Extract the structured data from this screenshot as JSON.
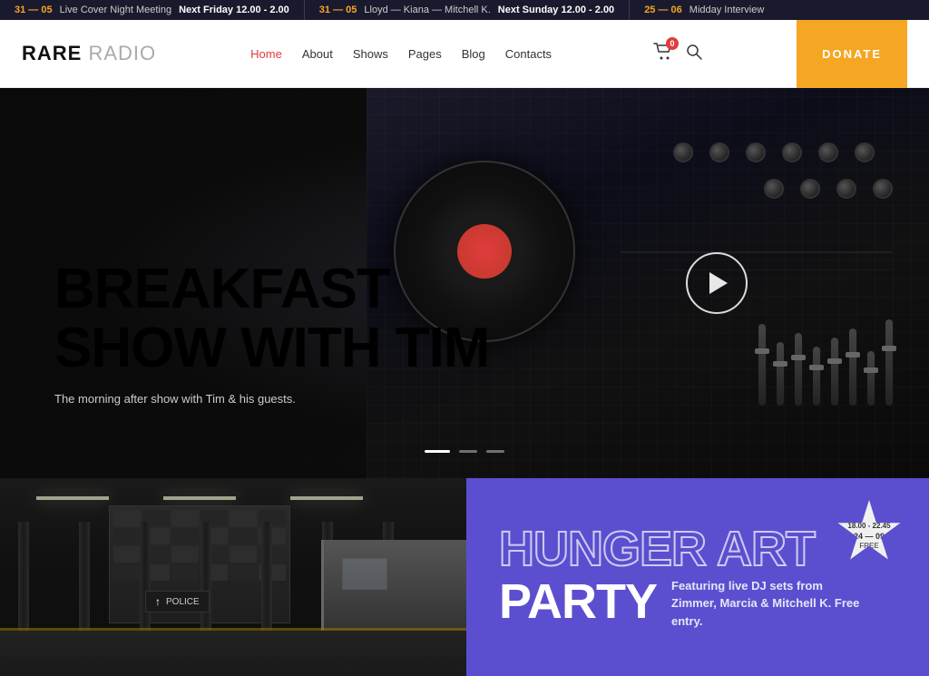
{
  "ticker": {
    "segments": [
      {
        "date": "31 — 05",
        "text": "Live Cover Night Meeting",
        "time": "Next Friday 12.00 - 2.00"
      },
      {
        "date": "31 — 05",
        "text": "Lloyd — Kiana — Mitchell K.",
        "time": "Next Sunday 12.00 - 2.00"
      },
      {
        "date": "25 — 06",
        "text": "Midday Interview",
        "time": ""
      }
    ]
  },
  "header": {
    "logo_bold": "RARE",
    "logo_thin": " RADIO",
    "nav": [
      {
        "label": "Home",
        "active": true
      },
      {
        "label": "About",
        "active": false
      },
      {
        "label": "Shows",
        "active": false
      },
      {
        "label": "Pages",
        "active": false
      },
      {
        "label": "Blog",
        "active": false
      },
      {
        "label": "Contacts",
        "active": false
      }
    ],
    "cart_badge": "0",
    "donate_label": "DONATE"
  },
  "hero": {
    "title_outline": "BREAKFAST",
    "title_solid": "SHOW WITH TIM",
    "subtitle": "The morning after show with Tim & his guests.",
    "slider_dots": [
      true,
      false,
      false
    ]
  },
  "bottom": {
    "police_sign": "POLICE",
    "event_badge_time": "18.00 - 22.45",
    "event_badge_date": "24 — 09",
    "event_badge_free": "FREE",
    "event_title_outline": "HUNGER ART",
    "event_title_solid": "PARTY",
    "event_description": "Featuring live DJ sets from Zimmer, Marcia & Mitchell K. Free entry."
  }
}
